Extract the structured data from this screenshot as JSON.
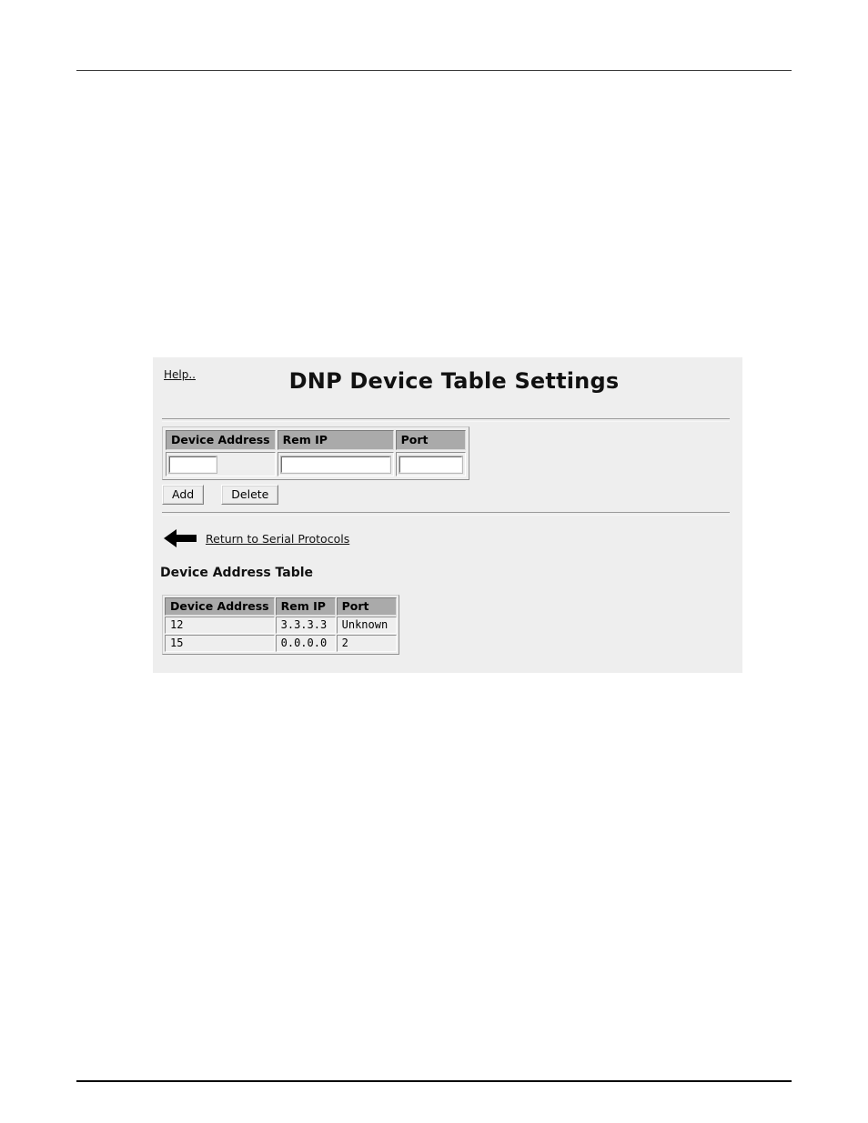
{
  "document": {
    "has_top_rule": true,
    "has_bottom_rule": true
  },
  "panel": {
    "background_color": "#eeeeee",
    "help_link": "Help..",
    "title": "DNP Device Table Settings",
    "entry_form": {
      "headers": [
        "Device Address",
        "Rem IP",
        "Port"
      ],
      "values": {
        "device_address": "",
        "rem_ip": "",
        "port": ""
      },
      "placeholders": {
        "device_address": "",
        "rem_ip": "",
        "port": ""
      }
    },
    "buttons": {
      "add": "Add",
      "delete": "Delete"
    },
    "return": {
      "icon": "left-arrow-icon",
      "label": "Return to Serial Protocols"
    },
    "device_table": {
      "caption": "Device Address Table",
      "headers": [
        "Device Address",
        "Rem IP",
        "Port"
      ],
      "rows": [
        {
          "device_address": "12",
          "rem_ip": "3.3.3.3",
          "port": "Unknown"
        },
        {
          "device_address": "15",
          "rem_ip": "0.0.0.0",
          "port": "2"
        }
      ]
    }
  }
}
